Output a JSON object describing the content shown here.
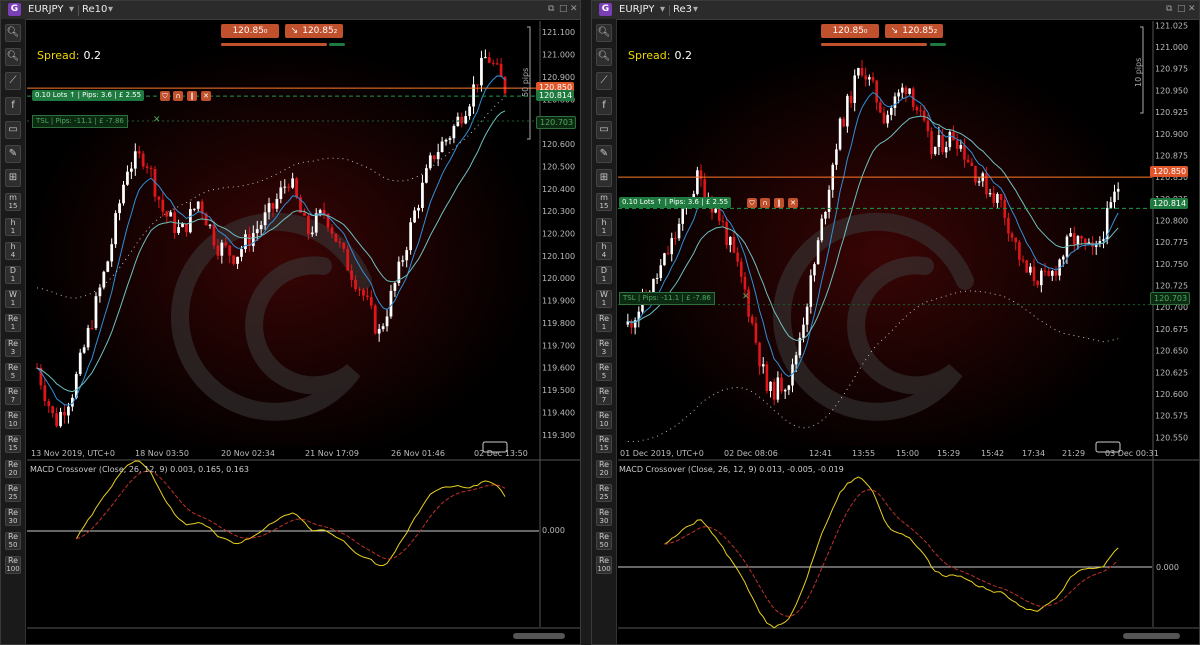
{
  "panels": [
    {
      "symbol": "EURJPY",
      "timeframe": "Re10",
      "spread_label": "Spread:",
      "spread_value": "0.2",
      "sell_price": "120.85₀",
      "buy_price": "120.85₂",
      "order_lots": "0.10 Lots ↑",
      "order_pips": "Pips: 3.6",
      "order_pnl": "£ 2.55",
      "tsl_label": "TSL",
      "tsl_pips": "Pips: -11.1",
      "tsl_pnl": "£ -7.86",
      "tag_current": "120.850",
      "tag_entry": "120.814",
      "tag_tsl": "120.703",
      "pips_label": "50 pips",
      "y_ticks": [
        "121.100",
        "121.000",
        "120.900",
        "120.800",
        "120.700",
        "120.600",
        "120.500",
        "120.400",
        "120.300",
        "120.200",
        "120.100",
        "120.000",
        "119.900",
        "119.800",
        "119.700",
        "119.600",
        "119.500",
        "119.400",
        "119.300"
      ],
      "x_ticks": [
        "13 Nov 2019, UTC+0",
        "18 Nov 03:50",
        "20 Nov 02:34",
        "21 Nov 17:09",
        "26 Nov 01:46",
        "02 Dec 13:50"
      ],
      "macd_label": "MACD Crossover (Close, 26, 12, 9) 0.003, 0.165, 0.163",
      "macd_zero": "0.000"
    },
    {
      "symbol": "EURJPY",
      "timeframe": "Re3",
      "spread_label": "Spread:",
      "spread_value": "0.2",
      "sell_price": "120.85₀",
      "buy_price": "120.85₂",
      "order_lots": "0.10 Lots ↑",
      "order_pips": "Pips: 3.6",
      "order_pnl": "£ 2.55",
      "tsl_label": "TSL",
      "tsl_pips": "Pips: -11.1",
      "tsl_pnl": "£ -7.86",
      "tag_current": "120.850",
      "tag_entry": "120.814",
      "tag_tsl": "120.703",
      "pips_label": "10 pips",
      "y_ticks": [
        "121.025",
        "121.000",
        "120.975",
        "120.950",
        "120.925",
        "120.900",
        "120.875",
        "120.850",
        "120.825",
        "120.800",
        "120.775",
        "120.750",
        "120.725",
        "120.700",
        "120.675",
        "120.650",
        "120.625",
        "120.600",
        "120.575",
        "120.550"
      ],
      "x_ticks": [
        "01 Dec 2019, UTC+0",
        "02 Dec 08:06",
        "12:41",
        "13:55",
        "15:00",
        "15:29",
        "15:42",
        "17:34",
        "21:29",
        "03 Dec 00:31"
      ],
      "macd_label": "MACD Crossover (Close, 26, 12, 9) 0.013, -0.005, -0.019",
      "macd_zero": "0.000"
    }
  ],
  "toolbar": [
    {
      "icon": "zoom-in-icon"
    },
    {
      "icon": "zoom-out-icon"
    },
    {
      "icon": "line-tool-icon"
    },
    {
      "icon": "facebook-icon"
    },
    {
      "icon": "chart-type-icon"
    },
    {
      "icon": "drawing-tools-icon"
    },
    {
      "icon": "indicators-icon"
    },
    {
      "l1": "m",
      "l2": "15"
    },
    {
      "l1": "h",
      "l2": "1"
    },
    {
      "l1": "h",
      "l2": "4"
    },
    {
      "l1": "D",
      "l2": "1"
    },
    {
      "l1": "W",
      "l2": "1"
    },
    {
      "l1": "Re",
      "l2": "1"
    },
    {
      "l1": "Re",
      "l2": "3"
    },
    {
      "l1": "Re",
      "l2": "5"
    },
    {
      "l1": "Re",
      "l2": "7"
    },
    {
      "l1": "Re",
      "l2": "10"
    },
    {
      "l1": "Re",
      "l2": "15"
    },
    {
      "l1": "Re",
      "l2": "20"
    },
    {
      "l1": "Re",
      "l2": "25"
    },
    {
      "l1": "Re",
      "l2": "30"
    },
    {
      "l1": "Re",
      "l2": "50"
    },
    {
      "l1": "Re",
      "l2": "100"
    }
  ],
  "colors": {
    "bull": "#ffffff",
    "bear": "#e0161b",
    "ema_fast": "#2f8fd8",
    "ema_slow": "#6fbfbf",
    "macd": "#e8d020",
    "signal": "#c0312a",
    "price_line": "#ff7a2a",
    "entry_line": "#1e9a4a"
  },
  "chart_data": [
    {
      "type": "candlestick",
      "title": "EURJPY Re10",
      "ylim": [
        119.25,
        121.15
      ],
      "indicators": [
        "MACD Crossover (Close, 26, 12, 9)"
      ],
      "close_path": [
        119.6,
        119.35,
        119.5,
        119.8,
        120.1,
        120.5,
        120.55,
        120.3,
        120.2,
        120.35,
        120.15,
        120.1,
        120.2,
        120.3,
        120.45,
        120.2,
        120.3,
        120.1,
        119.95,
        119.75,
        120.0,
        120.3,
        120.55,
        120.65,
        120.8,
        121.0,
        120.85
      ]
    },
    {
      "type": "candlestick",
      "title": "EURJPY Re3",
      "ylim": [
        120.54,
        121.03
      ],
      "indicators": [
        "MACD Crossover (Close, 26, 12, 9)"
      ],
      "close_path": [
        120.68,
        120.72,
        120.78,
        120.85,
        120.8,
        120.72,
        120.6,
        120.62,
        120.75,
        120.9,
        120.98,
        120.92,
        120.96,
        120.88,
        120.9,
        120.85,
        120.82,
        120.74,
        120.73,
        120.78,
        120.76,
        120.84
      ]
    }
  ]
}
